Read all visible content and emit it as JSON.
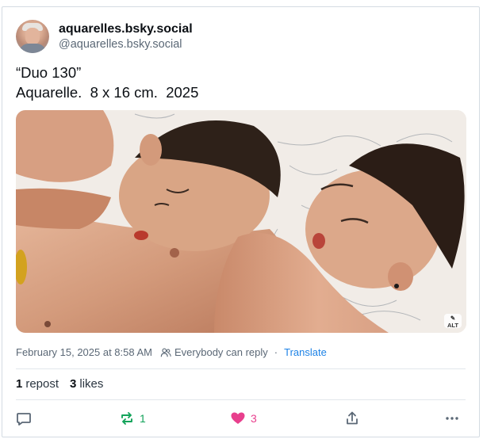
{
  "author": {
    "display_name": "aquarelles.bsky.social",
    "handle": "@aquarelles.bsky.social"
  },
  "post": {
    "text_lines": [
      "“Duo 130”",
      "Aquarelle.  8 x 16 cm.  2025"
    ],
    "image_alt_badge": "ALT"
  },
  "meta": {
    "timestamp": "February 15, 2025 at 8:58 AM",
    "reply_setting": "Everybody can reply",
    "separator": "·",
    "translate_label": "Translate"
  },
  "stats": {
    "reposts_count": "1",
    "reposts_label": "repost",
    "likes_count": "3",
    "likes_label": "likes"
  },
  "actions": {
    "repost_count": "1",
    "like_count": "3"
  },
  "colors": {
    "repost_active": "#13a35a",
    "like_active": "#e83f8d",
    "link": "#1d82e6",
    "secondary_text": "#5b6876"
  }
}
